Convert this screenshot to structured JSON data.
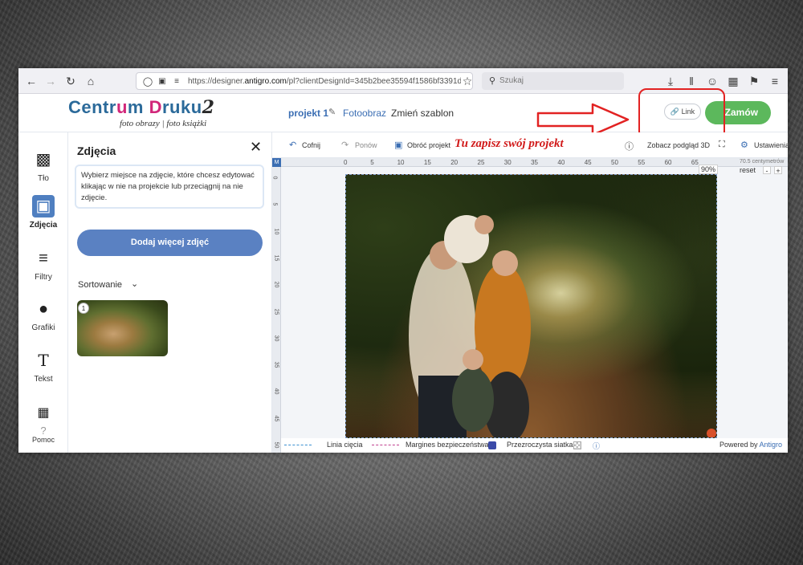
{
  "browser": {
    "url_prefix": "https://designer.",
    "url_host": "antigro.com",
    "url_suffix": "/pl?clientDesignId=345b2bee35594f1586bf3391d",
    "search_placeholder": "Szukaj"
  },
  "brand": {
    "logo_text_1": "Cent",
    "logo_text_r": "r",
    "logo_text_u": "u",
    "logo_text_2": "m ",
    "logo_text_D": "D",
    "logo_text_3": "ruku",
    "logo_text_num": "2",
    "logo_subtitle": "foto obrazy | foto książki"
  },
  "header": {
    "project_name": "projekt 1",
    "product_type": "Fotoobraz",
    "change_template": "Zmień szablon",
    "link_label": "Link",
    "order_label": "Zamów"
  },
  "tools": [
    {
      "label": "Tło",
      "icon": "background-icon"
    },
    {
      "label": "Zdjęcia",
      "icon": "image-icon"
    },
    {
      "label": "Filtry",
      "icon": "sliders-icon"
    },
    {
      "label": "Grafiki",
      "icon": "drop-icon"
    },
    {
      "label": "Tekst",
      "icon": "text-icon"
    },
    {
      "label": "Pomoc",
      "icon": "help-icon"
    }
  ],
  "photos_panel": {
    "title": "Zdjęcia",
    "info": "Wybierz miejsce na zdjęcie, które chcesz edytować klikając w nie na projekcie lub przeciągnij na nie zdjęcie.",
    "add_button": "Dodaj więcej zdjęć",
    "sort_label": "Sortowanie",
    "thumbnail_count": "1"
  },
  "editor_toolbar": {
    "undo": "Cofnij",
    "redo": "Ponów",
    "rotate": "Obróć projekt",
    "note": "Tu zapisz swój projekt",
    "preview_3d": "Zobacz podgląd 3D",
    "settings": "Ustawienia"
  },
  "ruler": {
    "corner": "M",
    "top_labels": [
      "0",
      "5",
      "10",
      "15",
      "20",
      "25",
      "30",
      "35",
      "40",
      "45",
      "50",
      "55",
      "60",
      "65"
    ],
    "left_labels": [
      "0",
      "5",
      "10",
      "15",
      "20",
      "25",
      "30",
      "35",
      "40",
      "45",
      "50"
    ],
    "zoom": "90%",
    "dims": "70.5 centymetrów",
    "reset": "reset",
    "zoom_out": "-",
    "zoom_in": "+"
  },
  "bottom_bar": {
    "cut_line": "Linia cięcia",
    "safety_margin": "Margines bezpieczeństwa",
    "transparent_grid": "Przezroczysta siatka",
    "powered_by": "Powered by ",
    "powered_brand": "Antigro"
  },
  "colors": {
    "accent_blue": "#3b6eb3",
    "button_blue": "#5a81c2",
    "order_green": "#5cb85c",
    "annotation_red": "#e22222"
  }
}
